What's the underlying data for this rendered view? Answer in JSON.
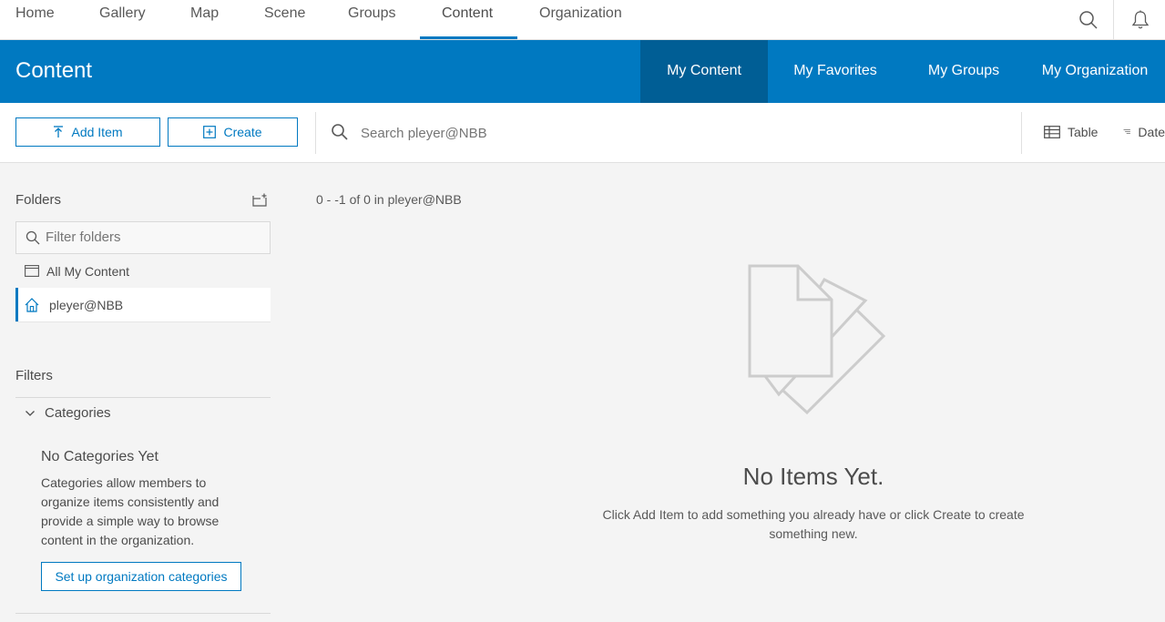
{
  "topnav": {
    "items": [
      {
        "label": "Home"
      },
      {
        "label": "Gallery"
      },
      {
        "label": "Map"
      },
      {
        "label": "Scene"
      },
      {
        "label": "Groups"
      },
      {
        "label": "Content"
      },
      {
        "label": "Organization"
      }
    ],
    "active": "Content",
    "icons": [
      "search-icon",
      "bell-icon"
    ]
  },
  "header": {
    "title": "Content",
    "tabs": [
      {
        "label": "My Content"
      },
      {
        "label": "My Favorites"
      },
      {
        "label": "My Groups"
      },
      {
        "label": "My Organization"
      }
    ],
    "active_tab": "My Content"
  },
  "toolbar": {
    "add_item_label": "Add Item",
    "create_label": "Create",
    "search_placeholder": "Search pleyer@NBB",
    "table_label": "Table",
    "date_label": "Date"
  },
  "sidebar": {
    "folders_title": "Folders",
    "filter_placeholder": "Filter folders",
    "folders": [
      {
        "label": "All My Content"
      },
      {
        "label": "pleyer@NBB"
      }
    ],
    "selected_folder": "pleyer@NBB",
    "filters_title": "Filters",
    "categories_title": "Categories",
    "no_categories_title": "No Categories Yet",
    "no_categories_desc": "Categories allow members to organize items consistently and provide a simple way to browse content in the organization.",
    "setup_button": "Set up organization categories"
  },
  "main": {
    "count_text": "0 - -1 of 0 in pleyer@NBB",
    "empty_title": "No Items Yet.",
    "empty_desc": "Click Add Item to add something you already have or click Create to create something new."
  },
  "colors": {
    "brand": "#0079c1",
    "brand_dark": "#005e95",
    "background": "#f4f4f4"
  }
}
